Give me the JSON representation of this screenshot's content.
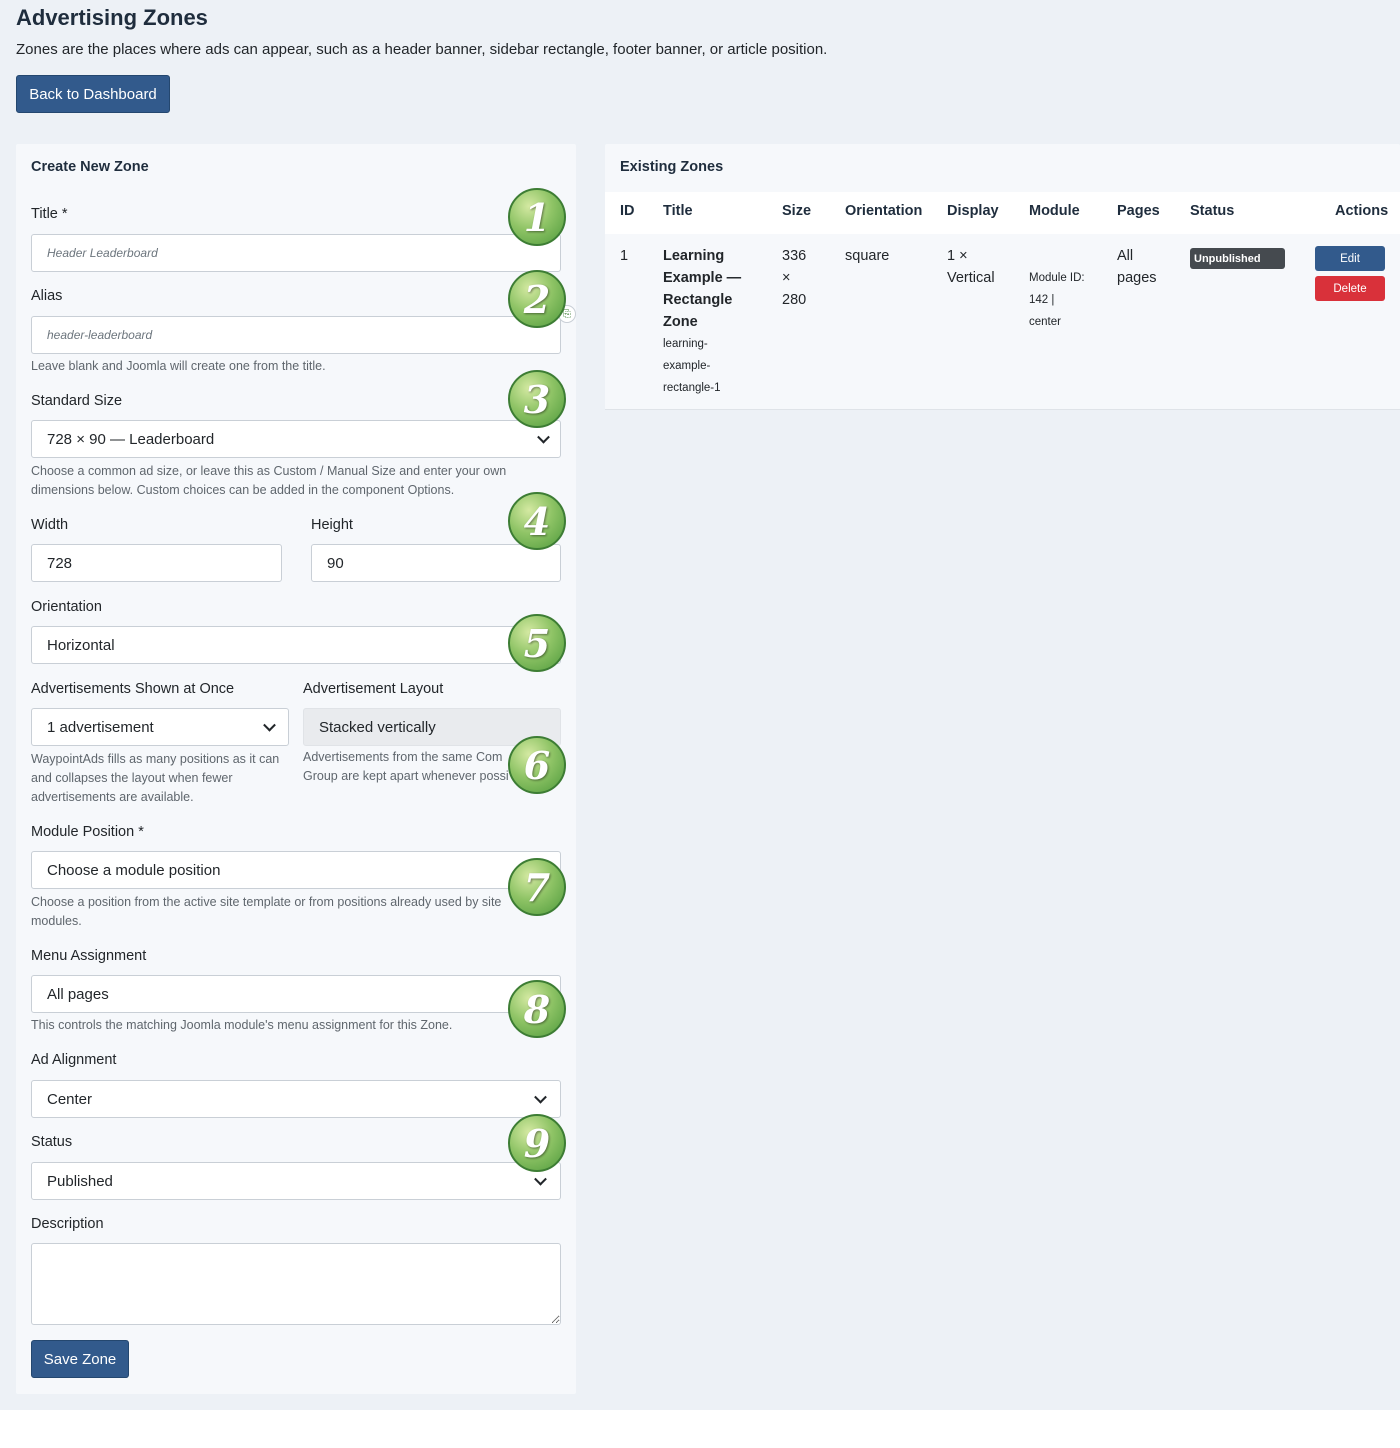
{
  "header": {
    "title": "Advertising Zones",
    "intro": "Zones are the places where ads can appear, such as a header banner, sidebar rectangle, footer banner, or article position.",
    "back_button": "Back to Dashboard"
  },
  "create_form": {
    "panel_title": "Create New Zone",
    "title_label": "Title *",
    "title_placeholder": "Header Leaderboard",
    "alias_label": "Alias",
    "alias_placeholder": "header-leaderboard",
    "alias_help": "Leave blank and Joomla will create one from the title.",
    "standard_size_label": "Standard Size",
    "standard_size_value": "728 × 90 — Leaderboard",
    "standard_size_help_1": "Choose a common ad size, or leave this as Custom / Manual Size and enter your own",
    "standard_size_help_2": "dimensions below. Custom choices can be added in the component Options.",
    "width_label": "Width",
    "width_value": "728",
    "height_label": "Height",
    "height_value": "90",
    "orientation_label": "Orientation",
    "orientation_value": "Horizontal",
    "ads_shown_label": "Advertisements Shown at Once",
    "ads_shown_value": "1 advertisement",
    "ads_shown_help_1": "WaypointAds fills as many positions as it can",
    "ads_shown_help_2": "and collapses the layout when fewer",
    "ads_shown_help_3": "advertisements are available.",
    "layout_label": "Advertisement Layout",
    "layout_value": "Stacked vertically",
    "layout_help_1": "Advertisements from the same Com",
    "layout_help_2": "Group are kept apart whenever possi",
    "module_position_label": "Module Position *",
    "module_position_value": "Choose a module position",
    "module_position_help_1": "Choose a position from the active site template or from positions already used by site",
    "module_position_help_2": "modules.",
    "menu_assignment_label": "Menu Assignment",
    "menu_assignment_value": "All pages",
    "menu_assignment_help": "This controls the matching Joomla module's menu assignment for this Zone.",
    "alignment_label": "Ad Alignment",
    "alignment_value": "Center",
    "status_label": "Status",
    "status_value": "Published",
    "description_label": "Description",
    "description_value": "",
    "save_button": "Save Zone"
  },
  "callouts": [
    "1",
    "2",
    "3",
    "4",
    "5",
    "6",
    "7",
    "8",
    "9"
  ],
  "zones_table": {
    "panel_title": "Existing Zones",
    "columns": [
      "ID",
      "Title",
      "Size",
      "Orientation",
      "Display",
      "Module",
      "Pages",
      "Status",
      "Actions"
    ],
    "rows": [
      {
        "id": "1",
        "title_lines": [
          "Learning",
          "Example —",
          "Rectangle",
          "Zone"
        ],
        "alias_lines": [
          "learning-",
          "example-",
          "rectangle-1"
        ],
        "size_lines": [
          "336",
          "×",
          "280"
        ],
        "orientation": "square",
        "display_lines": [
          "1 ×",
          "Vertical"
        ],
        "module_lines": [
          "Module ID:",
          "142 |",
          "center"
        ],
        "pages_lines": [
          "All",
          "pages"
        ],
        "status": "Unpublished",
        "edit_label": "Edit",
        "delete_label": "Delete"
      }
    ]
  },
  "colors": {
    "primary": "#325a8c",
    "danger": "#d9313a",
    "badge_dark": "#454a4f",
    "callout_green": "#5fa845"
  }
}
